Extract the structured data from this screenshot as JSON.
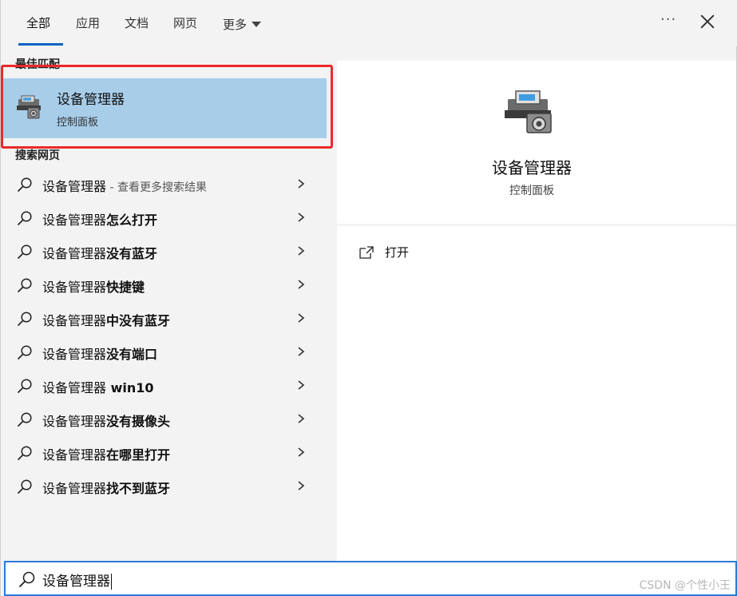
{
  "tabs": [
    {
      "label": "全部",
      "active": true
    },
    {
      "label": "应用",
      "active": false
    },
    {
      "label": "文档",
      "active": false
    },
    {
      "label": "网页",
      "active": false
    },
    {
      "label": "更多",
      "active": false
    }
  ],
  "header": {
    "more_options": "···"
  },
  "best_match": {
    "section_title": "最佳匹配",
    "title": "设备管理器",
    "subtitle": "控制面板"
  },
  "web_search": {
    "section_title": "搜索网页",
    "results": [
      {
        "prefix": "设备管理器",
        "suffix": "",
        "hint": " - 查看更多搜索结果"
      },
      {
        "prefix": "设备管理器",
        "suffix": "怎么打开",
        "hint": ""
      },
      {
        "prefix": "设备管理器",
        "suffix": "没有蓝牙",
        "hint": ""
      },
      {
        "prefix": "设备管理器",
        "suffix": "快捷键",
        "hint": ""
      },
      {
        "prefix": "设备管理器",
        "suffix": "中没有蓝牙",
        "hint": ""
      },
      {
        "prefix": "设备管理器",
        "suffix": "没有端口",
        "hint": ""
      },
      {
        "prefix": "设备管理器",
        "suffix": " win10",
        "hint": ""
      },
      {
        "prefix": "设备管理器",
        "suffix": "没有摄像头",
        "hint": ""
      },
      {
        "prefix": "设备管理器",
        "suffix": "在哪里打开",
        "hint": ""
      },
      {
        "prefix": "设备管理器",
        "suffix": "找不到蓝牙",
        "hint": ""
      }
    ]
  },
  "detail": {
    "title": "设备管理器",
    "subtitle": "控制面板",
    "actions": [
      {
        "label": "打开",
        "icon": "open-external-icon"
      }
    ]
  },
  "search": {
    "value": "设备管理器"
  },
  "watermark": "CSDN @个性小王",
  "colors": {
    "accent": "#0a64c4",
    "selection": "#a7cde9",
    "highlight_border": "#ec2a2a"
  }
}
